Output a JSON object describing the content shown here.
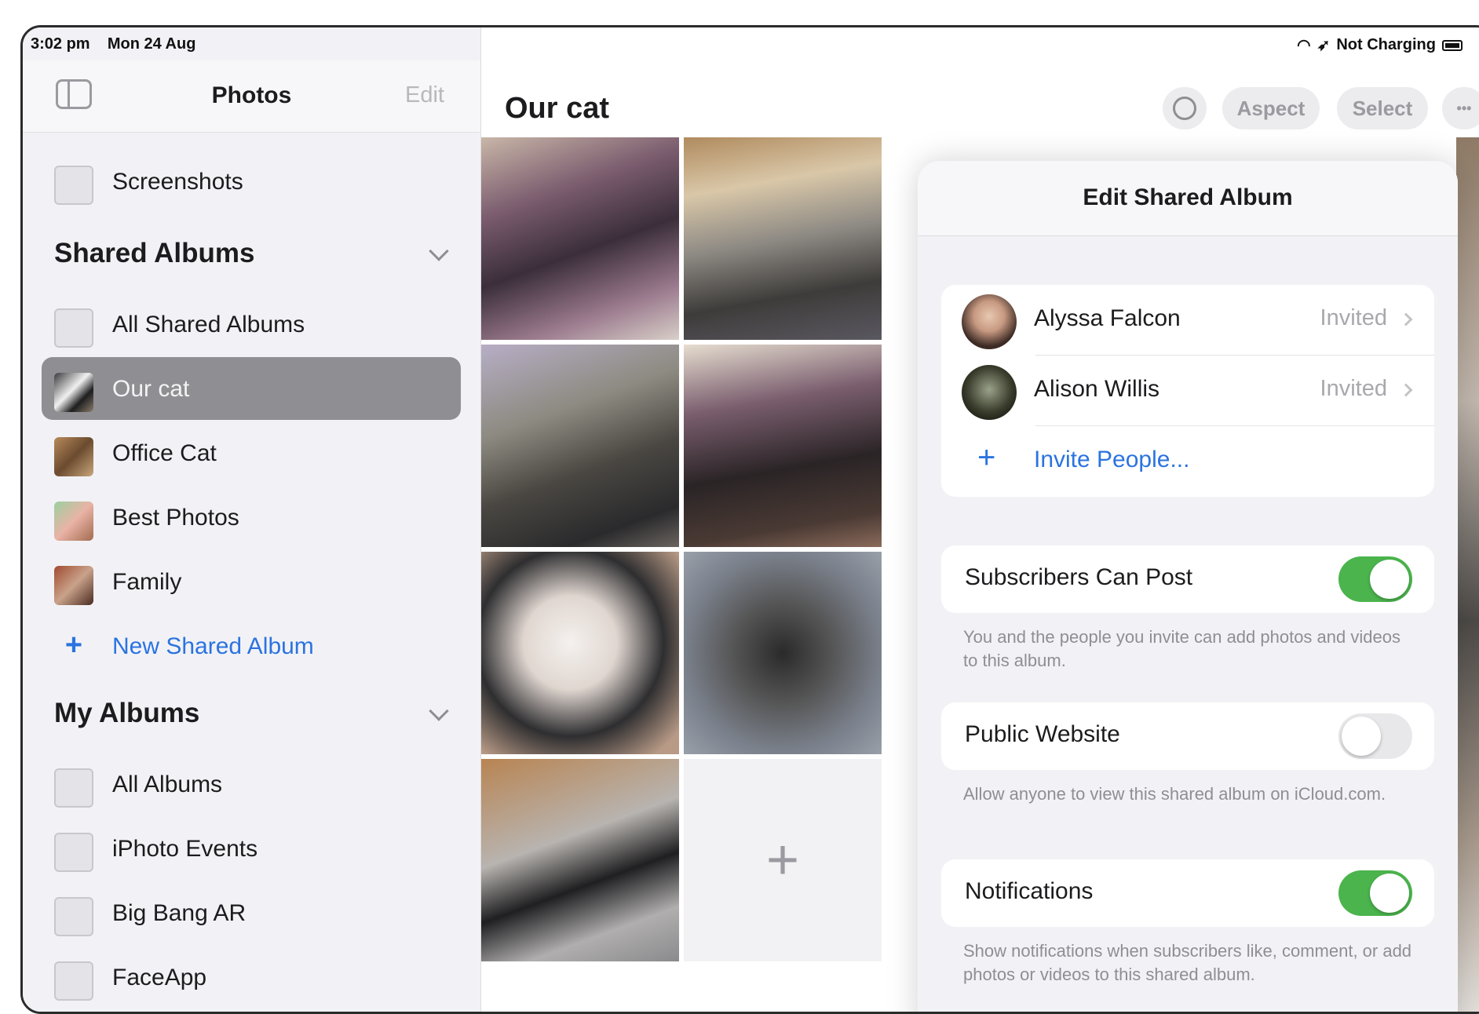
{
  "status": {
    "time": "3:02 pm",
    "date": "Mon 24 Aug",
    "charging": "Not Charging"
  },
  "sidebar": {
    "title": "Photos",
    "edit_label": "Edit",
    "screenshots_label": "Screenshots",
    "shared_section": "Shared Albums",
    "shared_items": [
      {
        "label": "All Shared Albums",
        "icon": "shared-albums-icon"
      },
      {
        "label": "Our cat",
        "icon": "album-thumbnail",
        "selected": true
      },
      {
        "label": "Office Cat",
        "icon": "album-thumbnail"
      },
      {
        "label": "Best Photos",
        "icon": "album-thumbnail"
      },
      {
        "label": "Family",
        "icon": "album-thumbnail"
      }
    ],
    "new_shared_album": "New Shared Album",
    "my_section": "My Albums",
    "my_items": [
      {
        "label": "All Albums",
        "icon": "albums-icon"
      },
      {
        "label": "iPhoto Events",
        "icon": "photo-stack-icon"
      },
      {
        "label": "Big Bang AR",
        "icon": "photo-stack-icon"
      },
      {
        "label": "FaceApp",
        "icon": "photo-stack-icon"
      }
    ]
  },
  "main": {
    "title": "Our cat",
    "buttons": {
      "aspect": "Aspect",
      "select": "Select",
      "more": "•••"
    },
    "add_symbol": "+"
  },
  "popover": {
    "title": "Edit Shared Album",
    "people": [
      {
        "name": "Alyssa Falcon",
        "status": "Invited"
      },
      {
        "name": "Alison Willis",
        "status": "Invited"
      }
    ],
    "invite_label": "Invite People...",
    "settings": [
      {
        "label": "Subscribers Can Post",
        "on": true,
        "description": "You and the people you invite can add photos and videos to this album."
      },
      {
        "label": "Public Website",
        "on": false,
        "description": "Allow anyone to view this shared album on iCloud.com."
      },
      {
        "label": "Notifications",
        "on": true,
        "description": "Show notifications when subscribers like, comment, or add photos or videos to this shared album."
      }
    ]
  },
  "colors": {
    "accent": "#2b73e0",
    "toggle_on": "#4bb44d",
    "selected_row": "#8e8e93"
  }
}
